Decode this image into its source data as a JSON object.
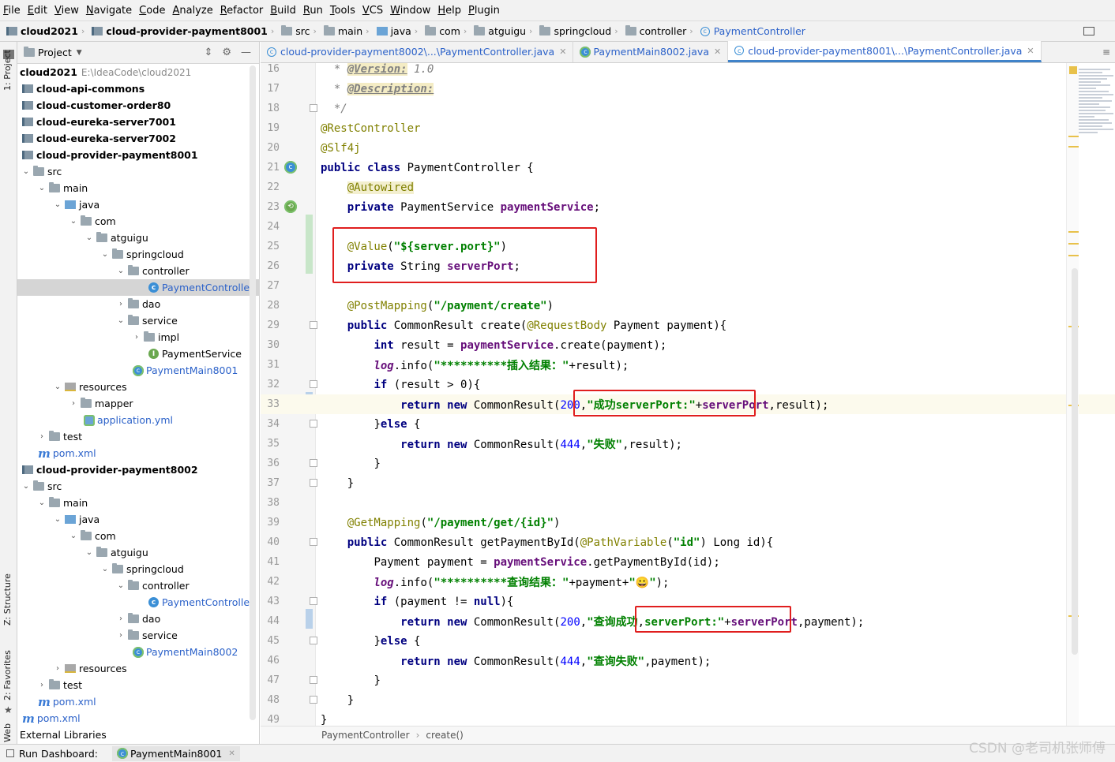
{
  "menu": [
    "File",
    "Edit",
    "View",
    "Navigate",
    "Code",
    "Analyze",
    "Refactor",
    "Build",
    "Run",
    "Tools",
    "VCS",
    "Window",
    "Help",
    "Plugin"
  ],
  "breadcrumbs": [
    "cloud2021",
    "cloud-provider-payment8001",
    "src",
    "main",
    "java",
    "com",
    "atguigu",
    "springcloud",
    "controller",
    "PaymentController"
  ],
  "left_tool": {
    "project": "1: Project",
    "structure": "Z: Structure",
    "favorites": "2: Favorites",
    "web": "Web"
  },
  "project_panel": {
    "title": "Project",
    "tree": [
      {
        "label": "cloud2021",
        "hint": "E:\\IdeaCode\\cloud2021"
      },
      {
        "label": "cloud-api-commons"
      },
      {
        "label": "cloud-customer-order80"
      },
      {
        "label": "cloud-eureka-server7001"
      },
      {
        "label": "cloud-eureka-server7002"
      },
      {
        "label": "cloud-provider-payment8001"
      },
      {
        "label": "src"
      },
      {
        "label": "main"
      },
      {
        "label": "java"
      },
      {
        "label": "com"
      },
      {
        "label": "atguigu"
      },
      {
        "label": "springcloud"
      },
      {
        "label": "controller"
      },
      {
        "label": "PaymentController"
      },
      {
        "label": "dao"
      },
      {
        "label": "service"
      },
      {
        "label": "impl"
      },
      {
        "label": "PaymentService"
      },
      {
        "label": "PaymentMain8001"
      },
      {
        "label": "resources"
      },
      {
        "label": "mapper"
      },
      {
        "label": "application.yml"
      },
      {
        "label": "test"
      },
      {
        "label": "pom.xml"
      },
      {
        "label": "cloud-provider-payment8002"
      },
      {
        "label": "src"
      },
      {
        "label": "main"
      },
      {
        "label": "java"
      },
      {
        "label": "com"
      },
      {
        "label": "atguigu"
      },
      {
        "label": "springcloud"
      },
      {
        "label": "controller"
      },
      {
        "label": "PaymentController"
      },
      {
        "label": "dao"
      },
      {
        "label": "service"
      },
      {
        "label": "PaymentMain8002"
      },
      {
        "label": "resources"
      },
      {
        "label": "test"
      },
      {
        "label": "pom.xml"
      },
      {
        "label": "pom.xml"
      },
      {
        "label": "External Libraries"
      }
    ]
  },
  "tabs": [
    {
      "label": "cloud-provider-payment8002\\...\\PaymentController.java"
    },
    {
      "label": "PaymentMain8002.java"
    },
    {
      "label": "cloud-provider-payment8001\\...\\PaymentController.java"
    }
  ],
  "editor": {
    "line_numbers": [
      "16",
      "17",
      "18",
      "19",
      "20",
      "21",
      "22",
      "23",
      "24",
      "25",
      "26",
      "27",
      "28",
      "29",
      "30",
      "31",
      "32",
      "33",
      "34",
      "35",
      "36",
      "37",
      "38",
      "39",
      "40",
      "41",
      "42",
      "43",
      "44",
      "45",
      "46",
      "47",
      "48",
      "49"
    ],
    "lines": {
      "l16": [
        "* ",
        "@Version:",
        " 1.0"
      ],
      "l17": [
        "* ",
        "@Description:"
      ],
      "l18": [
        "*/"
      ],
      "l19": [
        "@RestController"
      ],
      "l20": [
        "@Slf4j"
      ],
      "l21": [
        "public class",
        " PaymentController {"
      ],
      "l22": [
        "@Autowired"
      ],
      "l23": [
        "private",
        " PaymentService ",
        "paymentService",
        ";"
      ],
      "l25": [
        "@Value",
        "(",
        "\"${server.port}\"",
        ")"
      ],
      "l26": [
        "private",
        " String ",
        "serverPort",
        ";"
      ],
      "l28": [
        "@PostMapping",
        "(",
        "\"/payment/create\"",
        ")"
      ],
      "l29": [
        "public",
        " CommonResult create(",
        "@RequestBody",
        " Payment payment){"
      ],
      "l30": [
        "int",
        " result = ",
        "paymentService",
        ".create(payment);"
      ],
      "l31": [
        "log",
        ".info(",
        "\"**********插入结果：\"",
        "+result);"
      ],
      "l32": [
        "if",
        " (result > 0){"
      ],
      "l33": [
        "return new",
        " CommonResult(",
        "200",
        ",",
        "\"成功serverPort:\"",
        "+",
        "serverPort",
        ",result);"
      ],
      "l34": [
        "}",
        "else",
        " {"
      ],
      "l35": [
        "return new",
        " CommonResult(",
        "444",
        ",",
        "\"失败\"",
        ",result);"
      ],
      "l36": [
        "}"
      ],
      "l37": [
        "}"
      ],
      "l39": [
        "@GetMapping",
        "(",
        "\"/payment/get/{id}\"",
        ")"
      ],
      "l40": [
        "public",
        " CommonResult getPaymentById(",
        "@PathVariable",
        "(",
        "\"id\"",
        ") Long id){"
      ],
      "l41": [
        "Payment payment = ",
        "paymentService",
        ".getPaymentById(id);"
      ],
      "l42": [
        "log",
        ".info(",
        "\"**********查询结果：\"",
        "+payment+",
        "\"😀\"",
        ");"
      ],
      "l43": [
        "if",
        " (payment != ",
        "null",
        "){"
      ],
      "l44": [
        "return new",
        " CommonResult(",
        "200",
        ",",
        "\"查询成功",
        ",",
        "serverPort:\"",
        "+",
        "serverPort",
        ",payment);"
      ],
      "l45": [
        "}",
        "else",
        " {"
      ],
      "l46": [
        "return new",
        " CommonResult(",
        "444",
        ",",
        "\"查询失败\"",
        ",payment);"
      ],
      "l47": [
        "}"
      ],
      "l48": [
        "}"
      ],
      "l49": [
        "}"
      ]
    }
  },
  "code_breadcrumb": {
    "class": "PaymentController",
    "method": "create()"
  },
  "status": {
    "run_dashboard": "Run Dashboard:",
    "run_item": "PaymentMain8001"
  },
  "watermark": "CSDN @老司机张师傅"
}
